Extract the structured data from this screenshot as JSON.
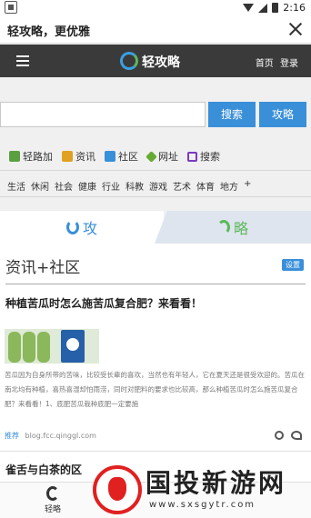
{
  "status_bar": {
    "time": "2:16"
  },
  "window": {
    "title": "轻攻略，更优雅"
  },
  "navbar": {
    "logo_text": "轻攻略",
    "links": [
      "首页",
      "登录"
    ]
  },
  "search": {
    "placeholder": "",
    "search_button": "搜索",
    "guide_button": "攻略"
  },
  "quick_links": [
    {
      "label": "轻路加",
      "icon": "share-icon"
    },
    {
      "label": "资讯",
      "icon": "news-icon"
    },
    {
      "label": "社区",
      "icon": "community-icon"
    },
    {
      "label": "网址",
      "icon": "sites-icon"
    },
    {
      "label": "搜索",
      "icon": "search-icon"
    }
  ],
  "categories": [
    "生活",
    "休闲",
    "社会",
    "健康",
    "行业",
    "科教",
    "游戏",
    "艺术",
    "体育",
    "地方",
    "+"
  ],
  "tabs": [
    {
      "label": "攻",
      "active": true
    },
    {
      "label": "略",
      "active": false
    }
  ],
  "section": {
    "title": "资讯+社区",
    "settings_label": "设置"
  },
  "article": {
    "title": "种植苦瓜时怎么施苦瓜复合肥？来看看！",
    "body": "苦瓜因为自身所带的苦味，比较受长辈的喜欢，当然也有年轻人，它在夏天还是很受欢迎的。苦瓜在南北均有种植，喜热喜湿却怕雨涝，同时对肥料的要求也比较高，那么种植苦瓜时怎么施苦瓜复合肥？来看看！1、底肥苦瓜栽种底肥一定要施",
    "tag": "推荐",
    "source": "blog.fcc.qinggl.com"
  },
  "article2": {
    "title": "雀舌与白茶的区"
  },
  "bottom_nav": {
    "label": "轻略"
  },
  "watermark": {
    "text": "国投新游网",
    "url": "www.sxsgytr.com"
  },
  "colors": {
    "accent_blue": "#3a8fd9",
    "navbar": "#3a3a3a",
    "accent_green": "#5cb85c"
  }
}
